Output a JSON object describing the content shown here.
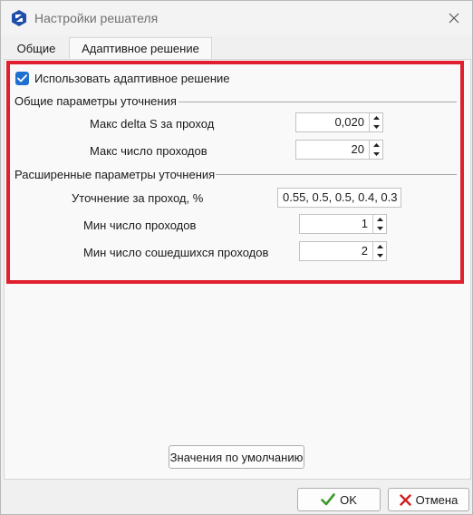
{
  "window": {
    "title": "Настройки решателя"
  },
  "tabs": [
    {
      "label": "Общие"
    },
    {
      "label": "Адаптивное решение"
    }
  ],
  "adaptive": {
    "use_adaptive_label": "Использовать адаптивное решение",
    "use_adaptive_checked": true
  },
  "general_refinement": {
    "title": "Общие параметры уточнения",
    "max_delta_s": {
      "label": "Макс delta S за проход",
      "value": "0,020"
    },
    "max_passes": {
      "label": "Макс число проходов",
      "value": "20"
    }
  },
  "advanced_refinement": {
    "title": "Расширенные параметры уточнения",
    "refinement_per_pass": {
      "label": "Уточнение за проход, %",
      "value": "0.55, 0.5, 0.5, 0.4, 0.3"
    },
    "min_passes": {
      "label": "Мин число проходов",
      "value": "1"
    },
    "min_converged_passes": {
      "label": "Мин число сошедшихся проходов",
      "value": "2"
    }
  },
  "buttons": {
    "defaults": "Значения по умолчанию",
    "ok": "OK",
    "cancel": "Отмена"
  },
  "colors": {
    "accent": "#1f6fd1",
    "highlight_border": "#e0202e",
    "ok_check": "#3a9a2a",
    "cancel_x": "#cc2020"
  },
  "icons": {
    "app": "solver-app-icon",
    "close": "close-icon",
    "ok": "checkmark-icon",
    "cancel": "cross-icon"
  }
}
